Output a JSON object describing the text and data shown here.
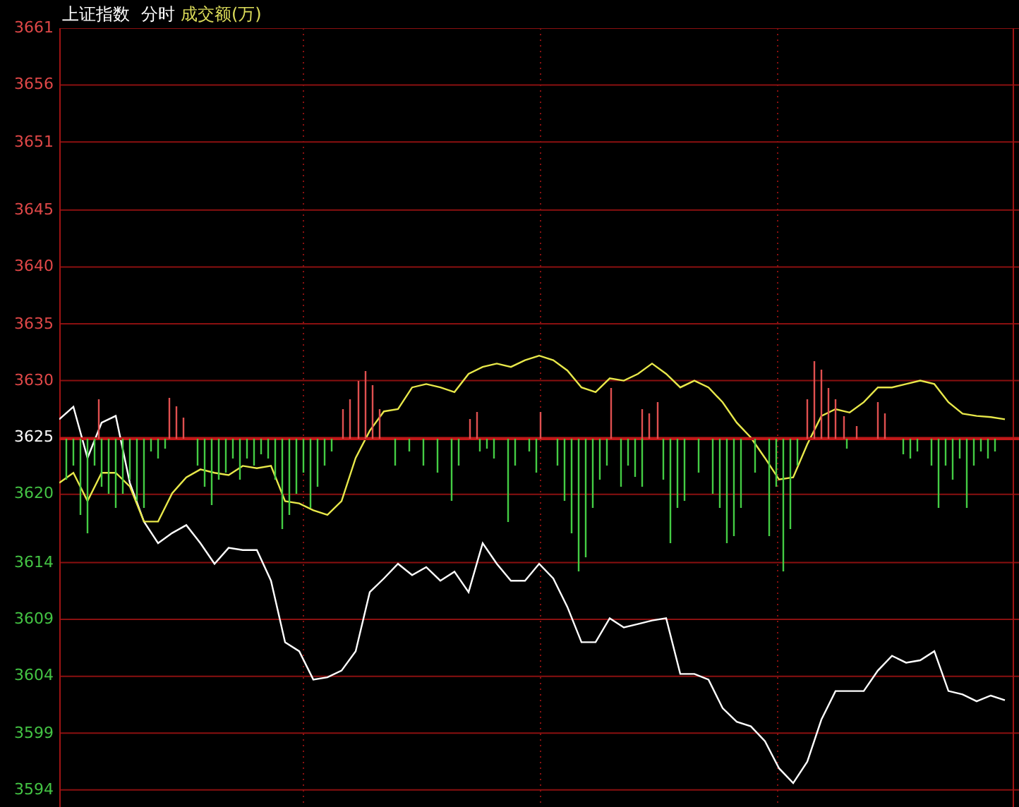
{
  "header": {
    "title": "上证指数",
    "mode": "分时",
    "indicator": "成交额(万)"
  },
  "chart_data": {
    "type": "line",
    "grid": true,
    "ylim": [
      3592.5,
      3661
    ],
    "yticks": [
      3661,
      3656,
      3651,
      3645,
      3640,
      3635,
      3630,
      3625,
      3620,
      3614,
      3609,
      3604,
      3599,
      3594
    ],
    "series": [
      {
        "color": "#ffffff",
        "values": [
          3626.6,
          3627.7,
          3623.2,
          3626.3,
          3626.9,
          3621.0,
          3617.6,
          3615.7,
          3616.6,
          3617.3,
          3615.7,
          3613.9,
          3615.3,
          3615.1,
          3615.1,
          3612.4,
          3607.0,
          3606.2,
          3603.7,
          3603.9,
          3604.5,
          3606.2,
          3611.4,
          3612.6,
          3613.9,
          3612.9,
          3613.6,
          3612.4,
          3613.2,
          3611.4,
          3615.7,
          3613.9,
          3612.4,
          3612.4,
          3613.9,
          3612.6,
          3610.1,
          3607.0,
          3607.0,
          3609.1,
          3608.3,
          3608.6,
          3608.9,
          3609.1,
          3604.2,
          3604.2,
          3603.7,
          3601.2,
          3600.0,
          3599.6,
          3598.3,
          3595.9,
          3594.6,
          3596.5,
          3600.2,
          3602.7,
          3602.7,
          3602.7,
          3604.5,
          3605.8,
          3605.2,
          3605.4,
          3606.2,
          3602.7,
          3602.4,
          3601.8,
          3602.3,
          3601.9
        ]
      },
      {
        "color": "#e8e84a",
        "values": [
          3621.0,
          3621.9,
          3619.4,
          3621.9,
          3621.9,
          3620.7,
          3617.6,
          3617.6,
          3620.1,
          3621.5,
          3622.2,
          3621.9,
          3621.7,
          3622.5,
          3622.3,
          3622.5,
          3619.4,
          3619.2,
          3618.6,
          3618.2,
          3619.4,
          3623.2,
          3625.6,
          3627.3,
          3627.5,
          3629.4,
          3629.7,
          3629.4,
          3629.0,
          3630.6,
          3631.2,
          3631.5,
          3631.2,
          3631.8,
          3632.2,
          3631.8,
          3630.9,
          3629.4,
          3629.0,
          3630.2,
          3630.0,
          3630.6,
          3631.5,
          3630.6,
          3629.4,
          3630.0,
          3629.4,
          3628.1,
          3626.3,
          3625.0,
          3623.2,
          3621.3,
          3621.5,
          3624.4,
          3626.9,
          3627.5,
          3627.2,
          3628.1,
          3629.4,
          3629.4,
          3629.7,
          3630.0,
          3629.7,
          3628.1,
          3627.1,
          3626.9,
          3626.8,
          3626.6
        ]
      }
    ]
  }
}
